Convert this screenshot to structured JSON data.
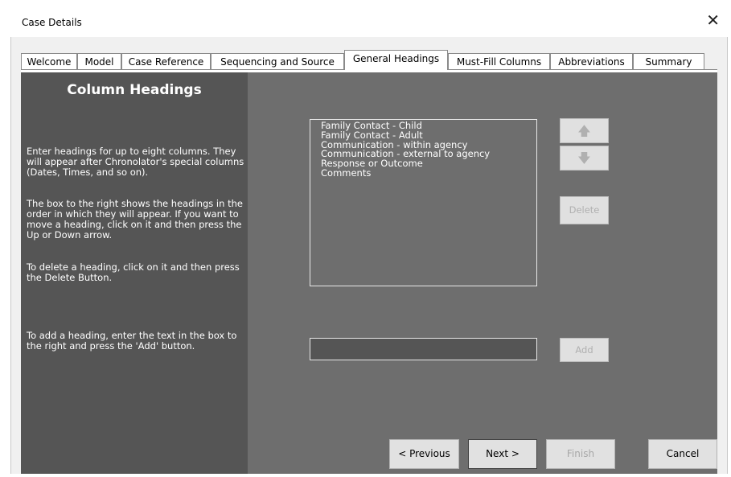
{
  "window": {
    "title": "Case Details",
    "close_glyph": "✕"
  },
  "tabs": [
    {
      "label": "Welcome",
      "active": false
    },
    {
      "label": "Model",
      "active": false
    },
    {
      "label": "Case Reference",
      "active": false
    },
    {
      "label": "Sequencing and Source",
      "active": false
    },
    {
      "label": "General Headings",
      "active": true
    },
    {
      "label": "Must-Fill Columns",
      "active": false
    },
    {
      "label": "Abbreviations",
      "active": false
    },
    {
      "label": "Summary",
      "active": false
    }
  ],
  "left_panel": {
    "heading": "Column Headings",
    "para1": "Enter headings for up to eight columns. They will appear after Chronolator's special columns (Dates, Times, and so on).",
    "para2": "The box to the right shows the headings in the order in which they will appear. If you want to move a heading, click on it and then press the Up or Down arrow.",
    "para3": "To delete a heading, click on it and then press the Delete Button.",
    "para4": "To add a heading, enter the text in the box to the right and press the 'Add' button."
  },
  "headings_list": [
    "Family Contact - Child",
    "Family Contact - Adult",
    "Communication - within agency",
    "Communication - external to agency",
    "Response or Outcome",
    "Comments"
  ],
  "buttons": {
    "up_glyph": "🡅",
    "down_glyph": "🡇",
    "delete": "Delete",
    "add": "Add",
    "previous": "< Previous",
    "next": "Next >",
    "finish": "Finish",
    "cancel": "Cancel"
  },
  "add_input": {
    "value": ""
  },
  "colors": {
    "panel": "#6e6e6e",
    "left_panel": "#555555",
    "input_bg": "#555555"
  }
}
